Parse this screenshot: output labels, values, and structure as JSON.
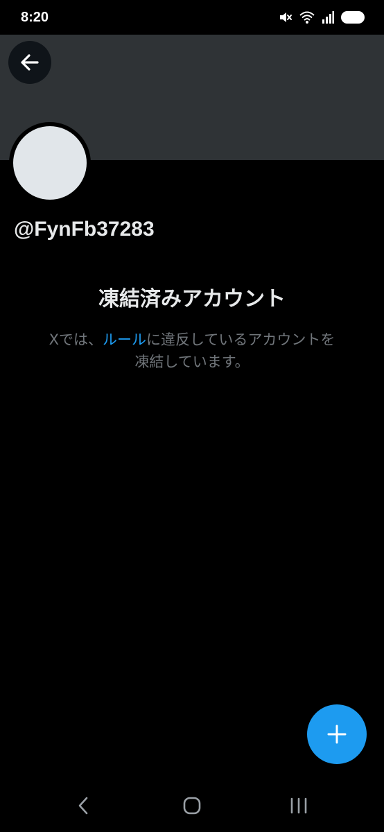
{
  "status_bar": {
    "time": "8:20",
    "icons": [
      "mute-icon",
      "wifi-icon",
      "signal-icon",
      "battery-icon"
    ]
  },
  "header": {
    "back_icon": "arrow-left-icon"
  },
  "profile": {
    "username": "@FynFb37283"
  },
  "suspended": {
    "title": "凍結済みアカウント",
    "desc_prefix": "Xでは、",
    "rules_link": "ルール",
    "desc_suffix_line1": "に違反しているアカウントを",
    "desc_line2": "凍結しています。"
  },
  "fab": {
    "icon": "plus-icon"
  },
  "nav_bar": {
    "icons": [
      "nav-back-icon",
      "nav-home-icon",
      "nav-recents-icon"
    ]
  },
  "colors": {
    "background": "#000000",
    "banner": "#2f3336",
    "avatar": "#e1e6ea",
    "text_primary": "#e7e9ea",
    "text_secondary": "#71767b",
    "accent": "#1d9bf0"
  }
}
